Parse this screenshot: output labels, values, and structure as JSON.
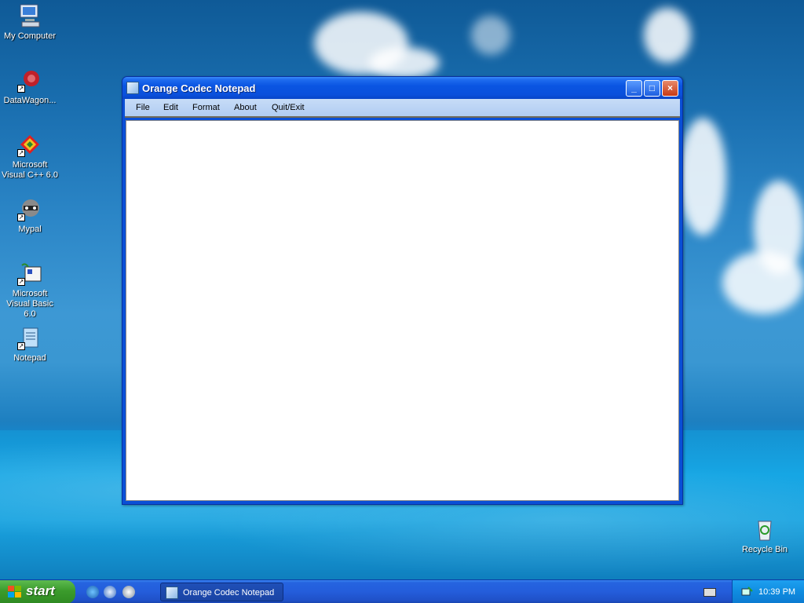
{
  "desktop": {
    "icons": [
      {
        "label": "My Computer"
      },
      {
        "label": "DataWagon..."
      },
      {
        "label": "Microsoft Visual C++ 6.0"
      },
      {
        "label": "Mypal"
      },
      {
        "label": "Microsoft Visual Basic 6.0"
      },
      {
        "label": "Notepad"
      },
      {
        "label": "Recycle Bin"
      }
    ]
  },
  "window": {
    "title": "Orange Codec Notepad",
    "buttons": {
      "minimize": "_",
      "maximize": "□",
      "close": "×"
    },
    "menu": [
      "File",
      "Edit",
      "Format",
      "About",
      "Quit/Exit"
    ],
    "editor_text": ""
  },
  "taskbar": {
    "start_label": "start",
    "task_button": "Orange Codec Notepad",
    "clock": "10:39 PM"
  },
  "colors": {
    "titlebar": "#0a55e2",
    "menubar": "#c7dcf7",
    "taskbar": "#245ddb",
    "start": "#3b9b2c"
  }
}
